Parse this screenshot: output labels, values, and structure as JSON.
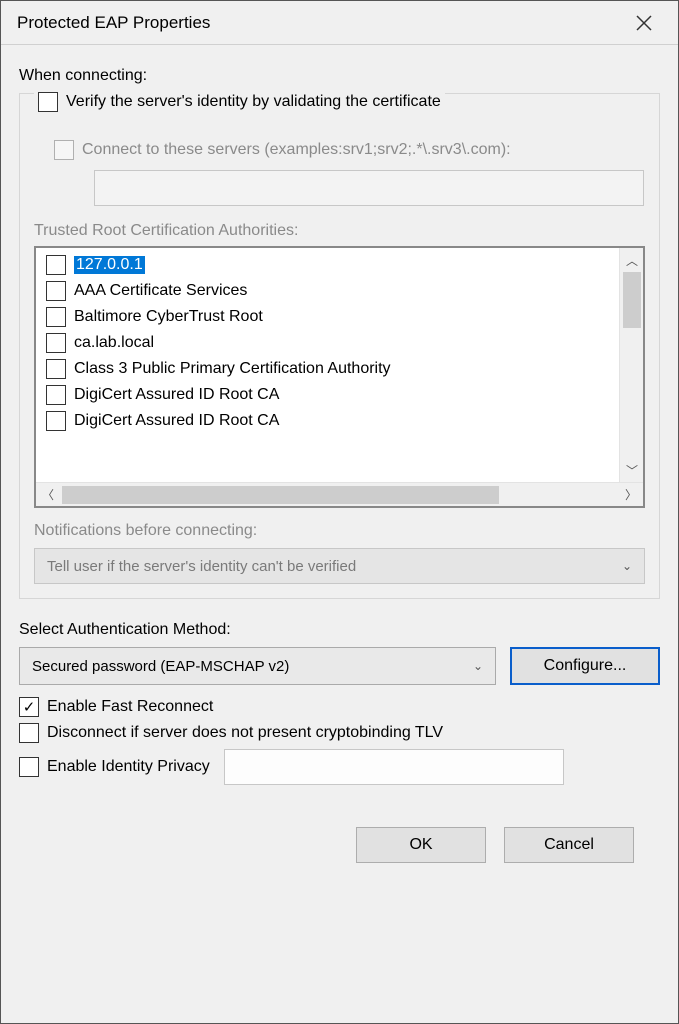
{
  "title": "Protected EAP Properties",
  "when_connecting_label": "When connecting:",
  "verify_server": {
    "label": "Verify the server's identity by validating the certificate",
    "checked": false
  },
  "connect_servers": {
    "label": "Connect to these servers (examples:srv1;srv2;.*\\.srv3\\.com):",
    "value": "",
    "enabled": false
  },
  "trusted_ca": {
    "label": "Trusted Root Certification Authorities:",
    "items": [
      {
        "label": "127.0.0.1",
        "checked": false,
        "selected": true
      },
      {
        "label": "AAA Certificate Services",
        "checked": false,
        "selected": false
      },
      {
        "label": "Baltimore CyberTrust Root",
        "checked": false,
        "selected": false
      },
      {
        "label": "ca.lab.local",
        "checked": false,
        "selected": false
      },
      {
        "label": "Class 3 Public Primary Certification Authority",
        "checked": false,
        "selected": false
      },
      {
        "label": "DigiCert Assured ID Root CA",
        "checked": false,
        "selected": false
      },
      {
        "label": "DigiCert Assured ID Root CA",
        "checked": false,
        "selected": false
      }
    ]
  },
  "notifications": {
    "label": "Notifications before connecting:",
    "value": "Tell user if the server's identity can't be verified",
    "enabled": false
  },
  "auth_method": {
    "label": "Select Authentication Method:",
    "value": "Secured password (EAP-MSCHAP v2)",
    "configure_label": "Configure..."
  },
  "fast_reconnect": {
    "label": "Enable Fast Reconnect",
    "checked": true
  },
  "disconnect_crypto": {
    "label": "Disconnect if server does not present cryptobinding TLV",
    "checked": false
  },
  "identity_privacy": {
    "label": "Enable Identity Privacy",
    "checked": false,
    "value": ""
  },
  "buttons": {
    "ok": "OK",
    "cancel": "Cancel"
  }
}
